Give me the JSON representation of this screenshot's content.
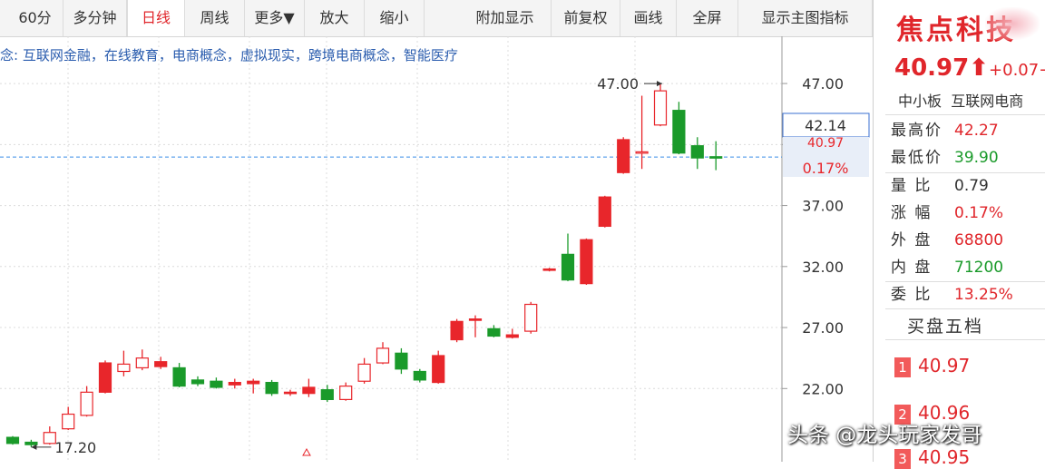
{
  "toolbar": {
    "items": [
      "60分",
      "多分钟",
      "日线",
      "周线",
      "更多▼",
      "放大",
      "缩小",
      "附加显示",
      "前复权",
      "画线",
      "全屏",
      "显示主图指标"
    ],
    "active": "日线"
  },
  "concepts_text": "念: 互联网金融，在线教育，电商概念，虚拟现实，跨境电商概念，智能医疗",
  "chart_data": {
    "type": "candlestick",
    "yticks": [
      47.0,
      42.0,
      37.0,
      32.0,
      27.0,
      22.0
    ],
    "ytick_labels": [
      "47.00",
      "",
      "37.00",
      "32.00",
      "27.00",
      "22.00"
    ],
    "ylim": [
      16.0,
      50.5
    ],
    "grid": true,
    "current_price": 40.97,
    "crosshair_price": "42.14",
    "price_tag": "40.97",
    "pct_tag": "0.17%",
    "annotations": [
      {
        "text": "47.00",
        "value": 47.0,
        "note": "period high"
      },
      {
        "text": "17.20",
        "value": 17.2,
        "note": "period low"
      }
    ],
    "candles": [
      {
        "o": 18.0,
        "c": 17.5,
        "h": 18.1,
        "l": 17.4
      },
      {
        "o": 17.6,
        "c": 17.4,
        "h": 17.8,
        "l": 17.2
      },
      {
        "o": 17.5,
        "c": 18.4,
        "h": 18.9,
        "l": 17.4
      },
      {
        "o": 18.7,
        "c": 19.9,
        "h": 20.5,
        "l": 18.6
      },
      {
        "o": 19.8,
        "c": 21.7,
        "h": 22.2,
        "l": 19.7
      },
      {
        "o": 21.7,
        "c": 24.1,
        "h": 24.3,
        "l": 21.6
      },
      {
        "o": 23.4,
        "c": 24.0,
        "h": 25.1,
        "l": 23.0
      },
      {
        "o": 23.7,
        "c": 24.5,
        "h": 25.2,
        "l": 23.5
      },
      {
        "o": 23.8,
        "c": 24.2,
        "h": 24.6,
        "l": 23.6
      },
      {
        "o": 23.7,
        "c": 22.2,
        "h": 24.1,
        "l": 22.1
      },
      {
        "o": 22.7,
        "c": 22.4,
        "h": 23.0,
        "l": 22.2
      },
      {
        "o": 22.6,
        "c": 22.1,
        "h": 22.9,
        "l": 22.0
      },
      {
        "o": 22.3,
        "c": 22.5,
        "h": 22.8,
        "l": 22.0
      },
      {
        "o": 22.4,
        "c": 22.6,
        "h": 22.8,
        "l": 21.6
      },
      {
        "o": 22.5,
        "c": 21.6,
        "h": 22.7,
        "l": 21.4
      },
      {
        "o": 21.6,
        "c": 21.7,
        "h": 21.9,
        "l": 21.4
      },
      {
        "o": 21.6,
        "c": 22.1,
        "h": 22.8,
        "l": 21.3
      },
      {
        "o": 21.9,
        "c": 21.1,
        "h": 22.3,
        "l": 20.9
      },
      {
        "o": 21.1,
        "c": 22.2,
        "h": 22.5,
        "l": 21.0
      },
      {
        "o": 22.6,
        "c": 24.0,
        "h": 24.5,
        "l": 22.4
      },
      {
        "o": 24.1,
        "c": 25.3,
        "h": 25.8,
        "l": 24.0
      },
      {
        "o": 24.9,
        "c": 23.6,
        "h": 25.3,
        "l": 23.2
      },
      {
        "o": 23.4,
        "c": 22.7,
        "h": 23.6,
        "l": 22.5
      },
      {
        "o": 22.5,
        "c": 24.7,
        "h": 25.1,
        "l": 22.4
      },
      {
        "o": 26.0,
        "c": 27.5,
        "h": 27.7,
        "l": 25.8
      },
      {
        "o": 27.6,
        "c": 27.7,
        "h": 28.0,
        "l": 26.2
      },
      {
        "o": 26.9,
        "c": 26.3,
        "h": 27.2,
        "l": 26.2
      },
      {
        "o": 26.2,
        "c": 26.4,
        "h": 26.9,
        "l": 26.1
      },
      {
        "o": 26.7,
        "c": 28.9,
        "h": 29.1,
        "l": 26.5
      },
      {
        "o": 31.7,
        "c": 31.8,
        "h": 31.9,
        "l": 31.6
      },
      {
        "o": 33.0,
        "c": 30.9,
        "h": 34.7,
        "l": 30.8
      },
      {
        "o": 30.6,
        "c": 34.2,
        "h": 34.3,
        "l": 30.5
      },
      {
        "o": 35.3,
        "c": 37.7,
        "h": 37.8,
        "l": 35.2
      },
      {
        "o": 39.7,
        "c": 42.4,
        "h": 42.6,
        "l": 39.6
      },
      {
        "o": 41.3,
        "c": 41.4,
        "h": 46.0,
        "l": 40.0
      },
      {
        "o": 43.6,
        "c": 46.4,
        "h": 47.0,
        "l": 43.5
      },
      {
        "o": 44.8,
        "c": 41.3,
        "h": 45.5,
        "l": 41.2
      },
      {
        "o": 41.9,
        "c": 40.9,
        "h": 42.6,
        "l": 40.0
      },
      {
        "o": 41.0,
        "c": 40.97,
        "h": 42.27,
        "l": 39.9
      }
    ]
  },
  "quote": {
    "name": "焦点科技",
    "price": "40.97",
    "change": "+0.07",
    "change_tail": "+",
    "tags": [
      "中小板",
      "互联网电商"
    ],
    "stats": [
      {
        "label": "最高价",
        "value": "42.27",
        "color": "#e0262b"
      },
      {
        "label": "最低价",
        "value": "39.90",
        "color": "#1a9a2a"
      },
      {
        "label": "量 比",
        "value": "0.79",
        "color": "#333333"
      },
      {
        "label": "涨 幅",
        "value": "0.17%",
        "color": "#e0262b"
      },
      {
        "label": "外 盘",
        "value": "68800",
        "color": "#e0262b"
      },
      {
        "label": "内 盘",
        "value": "71200",
        "color": "#1a9a2a"
      },
      {
        "label": "委 比",
        "value": "13.25%",
        "color": "#e0262b"
      }
    ],
    "buy_title": "买盘五档",
    "buy_levels": [
      {
        "idx": "1",
        "price": "40.97"
      },
      {
        "idx": "2",
        "price": "40.96"
      },
      {
        "idx": "3",
        "price": "40.95"
      }
    ]
  },
  "watermark": "头条 @龙头玩家发哥",
  "colors": {
    "up": "#e8262b",
    "down": "#1a9a2a",
    "grid": "#dcdcdc",
    "price_line": "#3a8ee6"
  }
}
